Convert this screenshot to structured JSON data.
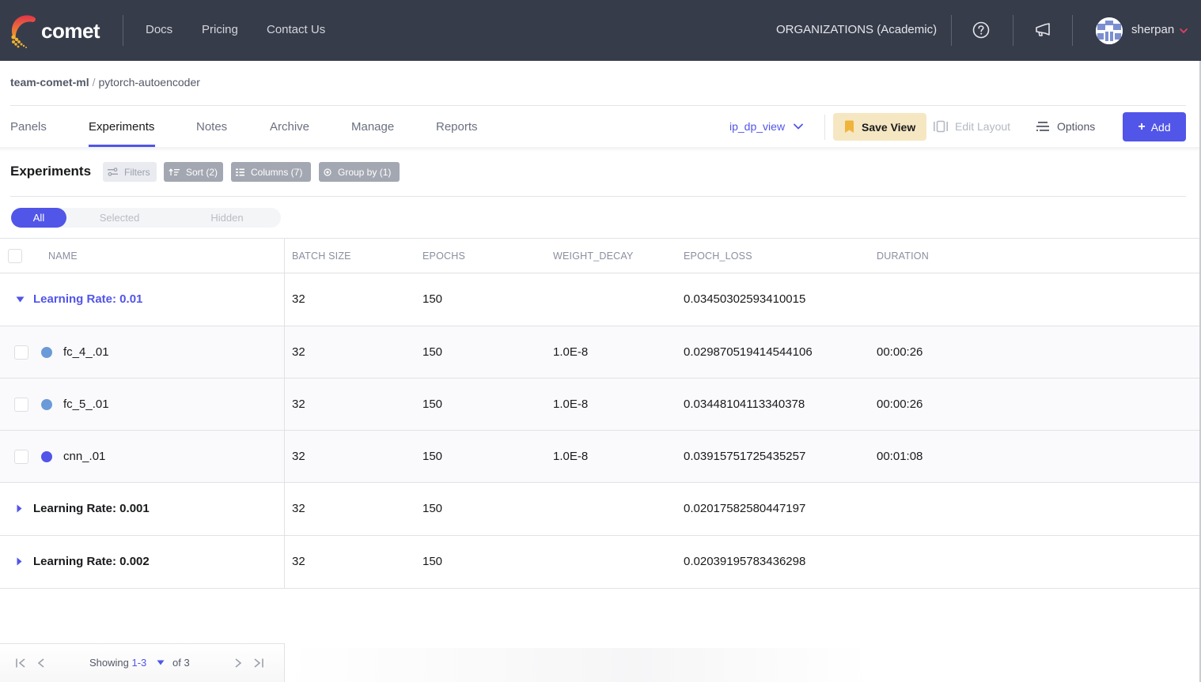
{
  "topnav": {
    "brand": "comet",
    "links": [
      "Docs",
      "Pricing",
      "Contact Us"
    ],
    "organization": "ORGANIZATIONS (Academic)",
    "username": "sherpan",
    "icons": [
      "help-icon",
      "announcement-icon",
      "chevron-down-icon"
    ]
  },
  "breadcrumb": {
    "workspace": "team-comet-ml",
    "separator": "/",
    "project": "pytorch-autoencoder"
  },
  "tabs": [
    {
      "label": "Panels",
      "active": false
    },
    {
      "label": "Experiments",
      "active": true
    },
    {
      "label": "Notes",
      "active": false
    },
    {
      "label": "Archive",
      "active": false
    },
    {
      "label": "Manage",
      "active": false
    },
    {
      "label": "Reports",
      "active": false
    }
  ],
  "toolbar": {
    "view_name": "ip_dp_view",
    "save_view": "Save View",
    "edit_layout": "Edit Layout",
    "options": "Options",
    "add": "Add"
  },
  "experiments": {
    "title": "Experiments",
    "chips": {
      "filters": "Filters",
      "sort": "Sort (2)",
      "columns": "Columns (7)",
      "group_by": "Group by (1)"
    },
    "segments": [
      "All",
      "Selected",
      "Hidden"
    ],
    "active_segment": "All"
  },
  "table": {
    "columns": [
      "NAME",
      "BATCH SIZE",
      "EPOCHS",
      "WEIGHT_DECAY",
      "EPOCH_LOSS",
      "DURATION"
    ],
    "rows": [
      {
        "type": "group",
        "expanded": true,
        "name": "Learning Rate: 0.01",
        "batch_size": "32",
        "epochs": "150",
        "weight_decay": "",
        "epoch_loss": "0.03450302593410015",
        "duration": ""
      },
      {
        "type": "experiment",
        "name": "fc_4_.01",
        "color": "#6a9bd8",
        "batch_size": "32",
        "epochs": "150",
        "weight_decay": "1.0E-8",
        "epoch_loss": "0.029870519414544106",
        "duration": "00:00:26"
      },
      {
        "type": "experiment",
        "name": "fc_5_.01",
        "color": "#6a9bd8",
        "batch_size": "32",
        "epochs": "150",
        "weight_decay": "1.0E-8",
        "epoch_loss": "0.03448104113340378",
        "duration": "00:00:26"
      },
      {
        "type": "experiment",
        "name": "cnn_.01",
        "color": "#5155e8",
        "batch_size": "32",
        "epochs": "150",
        "weight_decay": "1.0E-8",
        "epoch_loss": "0.03915751725435257",
        "duration": "00:01:08"
      },
      {
        "type": "group",
        "expanded": false,
        "name": "Learning Rate: 0.001",
        "batch_size": "32",
        "epochs": "150",
        "weight_decay": "",
        "epoch_loss": "0.02017582580447197",
        "duration": ""
      },
      {
        "type": "group",
        "expanded": false,
        "name": "Learning Rate: 0.002",
        "batch_size": "32",
        "epochs": "150",
        "weight_decay": "",
        "epoch_loss": "0.02039195783436298",
        "duration": ""
      }
    ]
  },
  "pagination": {
    "showing_label": "Showing",
    "range": "1-3",
    "of_label": "of 3"
  },
  "colors": {
    "accent": "#5155e8",
    "topbar": "#373c4b",
    "save_view_bg": "#f6e7c3"
  }
}
